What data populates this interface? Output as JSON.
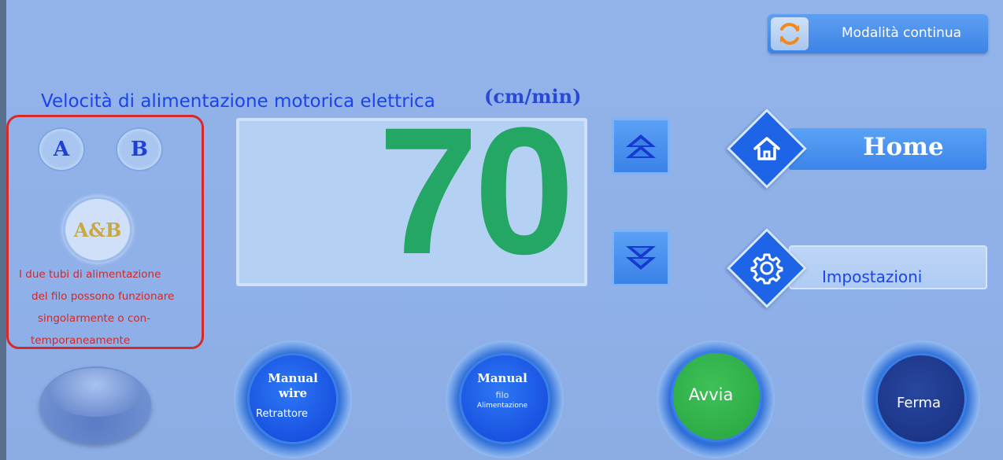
{
  "continuous_mode": {
    "label": "Modalità continua",
    "icon": "refresh-icon"
  },
  "speed": {
    "title": "Velocità di alimentazione motorica elettrica",
    "unit": "(cm/min)",
    "value": "70"
  },
  "selector": {
    "a_label": "A",
    "b_label": "B",
    "ab_label": "A&B",
    "note_lines": [
      "I due tubi di alimentazione",
      "del filo possono funzionare",
      "singolarmente o con-",
      "temporaneamente"
    ]
  },
  "nav": {
    "home_label": "Home",
    "settings_label": "Impostazioni"
  },
  "buttons": {
    "retract": {
      "title": "Manual\nwire",
      "title_line1": "Manual",
      "title_line2": "wire",
      "subtitle": "Retrattore"
    },
    "feed": {
      "title": "Manual",
      "subtitle_line1": "filo",
      "subtitle_line2": "Alimentazione"
    },
    "start": {
      "label": "Avvia"
    },
    "stop": {
      "label": "Ferma"
    }
  },
  "colors": {
    "background": "#8fb0e8",
    "speed_digits": "#24a664",
    "panel_border": "#d62a2a",
    "start": "#2fae47",
    "stop": "#1e3a96",
    "blue_button": "#1f5fe8"
  }
}
